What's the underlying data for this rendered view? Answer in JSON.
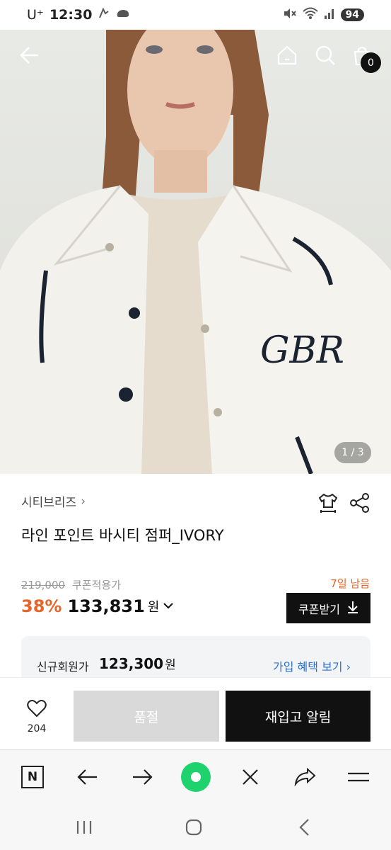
{
  "status_bar": {
    "carrier": "U⁺",
    "time": "12:30",
    "battery": "94"
  },
  "top_bar": {
    "cart_count": "0"
  },
  "gallery": {
    "page_indicator": "1 / 3"
  },
  "product": {
    "brand": "시티브리즈",
    "brand_chevron": "›",
    "title": "라인 포인트 바시티 점퍼_IVORY",
    "original_price": "219,000",
    "coupon_note": "쿠폰적용가",
    "days_left": "7일 남음",
    "discount": "38%",
    "price": "133,831",
    "currency": "원",
    "price_chevron": "⌄",
    "coupon_button": "쿠폰받기"
  },
  "member": {
    "label": "신규회원가",
    "price": "123,300",
    "currency": "원",
    "link": "가입 혜택 보기 ›"
  },
  "action_bar": {
    "likes": "204",
    "soldout_label": "품절",
    "restock_label": "재입고 알림"
  },
  "browser_bar": {
    "n_label": "N"
  }
}
